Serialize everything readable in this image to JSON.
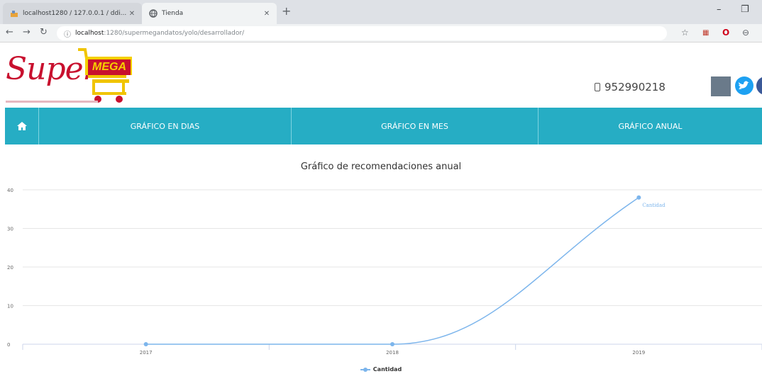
{
  "browser": {
    "tabs": [
      {
        "title": "localhost1280 / 127.0.0.1 / ddi..."
      },
      {
        "title": "Tienda"
      }
    ],
    "url_host": "localhost",
    "url_path": ":1280/supermegandatos/yolo/desarrollador/"
  },
  "site": {
    "logo_text": "Super",
    "logo_badge": "MEGA",
    "phone": "952990218",
    "nav": [
      {
        "label": "GRÁFICO EN DIAS"
      },
      {
        "label": "GRÁFICO EN MES"
      },
      {
        "label": "GRÁFICO ANUAL"
      }
    ]
  },
  "chart_data": {
    "type": "line",
    "title": "Gráfico de recomendaciones anual",
    "categories": [
      "2017",
      "2018",
      "2019"
    ],
    "series": [
      {
        "name": "Cantidad",
        "values": [
          0,
          0,
          38
        ]
      }
    ],
    "yticks": [
      "0",
      "10",
      "20",
      "30",
      "40"
    ],
    "ylim": [
      0,
      40
    ],
    "grid": true,
    "legend": "bottom",
    "data_label": "Cantidad",
    "color": "#7cb5ec"
  }
}
